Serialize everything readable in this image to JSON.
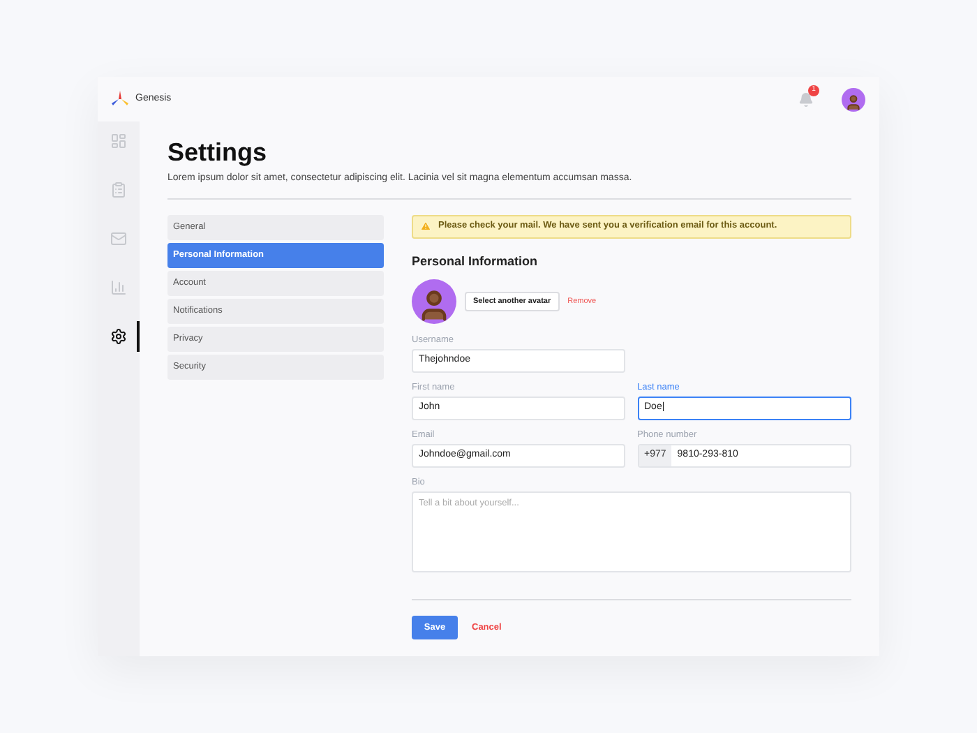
{
  "brand": {
    "name": "Genesis"
  },
  "header": {
    "notification_count": "1"
  },
  "sidebar": {
    "items": [
      {
        "kind": "dashboard",
        "selected": false
      },
      {
        "kind": "clipboard",
        "selected": false
      },
      {
        "kind": "mail",
        "selected": false
      },
      {
        "kind": "chart",
        "selected": false
      },
      {
        "kind": "settings",
        "selected": true
      }
    ]
  },
  "page": {
    "title": "Settings",
    "subtitle": "Lorem ipsum dolor sit amet, consectetur adipiscing elit. Lacinia vel sit magna elementum accumsan massa."
  },
  "settings_nav": [
    {
      "label": "General",
      "selected": false
    },
    {
      "label": "Personal Information",
      "selected": true
    },
    {
      "label": "Account",
      "selected": false
    },
    {
      "label": "Notifications",
      "selected": false
    },
    {
      "label": "Privacy",
      "selected": false
    },
    {
      "label": "Security",
      "selected": false
    }
  ],
  "alert": {
    "text": "Please check your mail. We have sent you a verification email for this account."
  },
  "section": {
    "title": "Personal Information",
    "select_avatar": "Select another avatar",
    "remove": "Remove"
  },
  "fields": [
    {
      "label": "Username",
      "value": "Thejohndoe",
      "focused": false
    },
    {
      "label": "First name",
      "value": "John",
      "focused": false
    },
    {
      "label": "Last name",
      "value": "Doe|",
      "focused": true
    },
    {
      "label": "Email",
      "value": "Johndoe@gmail.com",
      "focused": false
    },
    {
      "label": "Phone number",
      "prefix": "+977",
      "value": "9810-293-810",
      "focused": false
    }
  ],
  "bio": {
    "label": "Bio",
    "placeholder": "Tell a bit about yourself..."
  },
  "buttons": {
    "save": "Save",
    "cancel": "Cancel"
  }
}
